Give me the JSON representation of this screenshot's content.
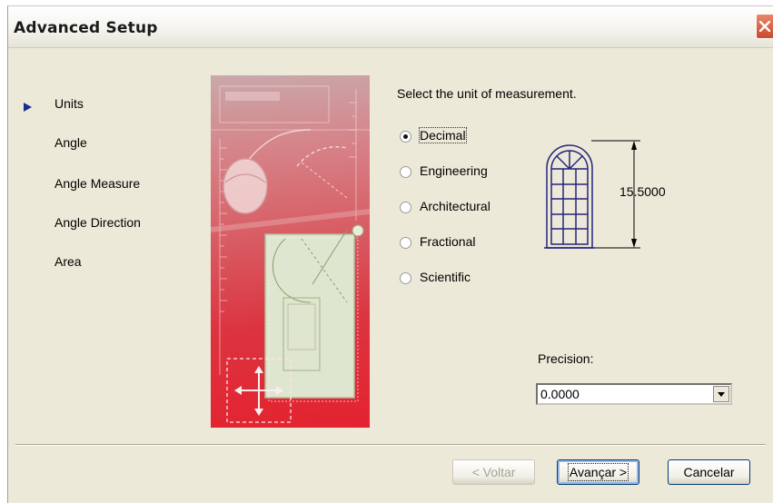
{
  "dialog": {
    "title": "Advanced Setup",
    "close_icon": "close-icon",
    "accent_color": "#1c2c8f"
  },
  "steps": [
    {
      "label": "Units",
      "current": true
    },
    {
      "label": "Angle",
      "current": false
    },
    {
      "label": "Angle Measure",
      "current": false
    },
    {
      "label": "Angle Direction",
      "current": false
    },
    {
      "label": "Area",
      "current": false
    }
  ],
  "units": {
    "prompt": "Select the unit of measurement.",
    "options": [
      {
        "label": "Decimal",
        "mnemonic": "D",
        "checked": true
      },
      {
        "label": "Engineering",
        "mnemonic": "E",
        "checked": false
      },
      {
        "label": "Architectural",
        "mnemonic": "A",
        "checked": false
      },
      {
        "label": "Fractional",
        "mnemonic": "c",
        "checked": false
      },
      {
        "label": "Scientific",
        "mnemonic": "S",
        "checked": false
      }
    ],
    "preview_dimension": "15.5000"
  },
  "precision": {
    "label": "Precision:",
    "value": "0.0000"
  },
  "buttons": {
    "back": "< Voltar",
    "next": "Avançar >",
    "cancel": "Cancelar"
  }
}
